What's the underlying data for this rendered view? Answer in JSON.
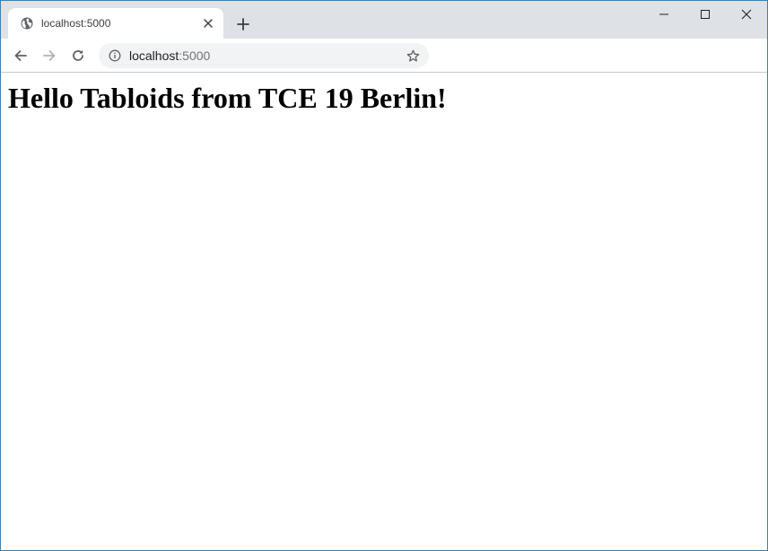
{
  "tab": {
    "title": "localhost:5000",
    "favicon": "globe-icon",
    "close_icon": "close-icon"
  },
  "new_tab_icon": "plus-icon",
  "window_controls": {
    "minimize_icon": "minimize-icon",
    "maximize_icon": "maximize-icon",
    "close_icon": "close-icon"
  },
  "toolbar": {
    "back_icon": "arrow-left-icon",
    "forward_icon": "arrow-right-icon",
    "reload_icon": "reload-icon"
  },
  "address_bar": {
    "host": "localhost",
    "port": ":5000",
    "info_icon": "info-icon",
    "bookmark_icon": "star-icon"
  },
  "page": {
    "heading": "Hello Tabloids from TCE 19 Berlin!"
  },
  "colors": {
    "tabstrip_bg": "#dee1e6",
    "omnibox_bg": "#f1f3f4",
    "window_border": "#3c7fb1"
  }
}
